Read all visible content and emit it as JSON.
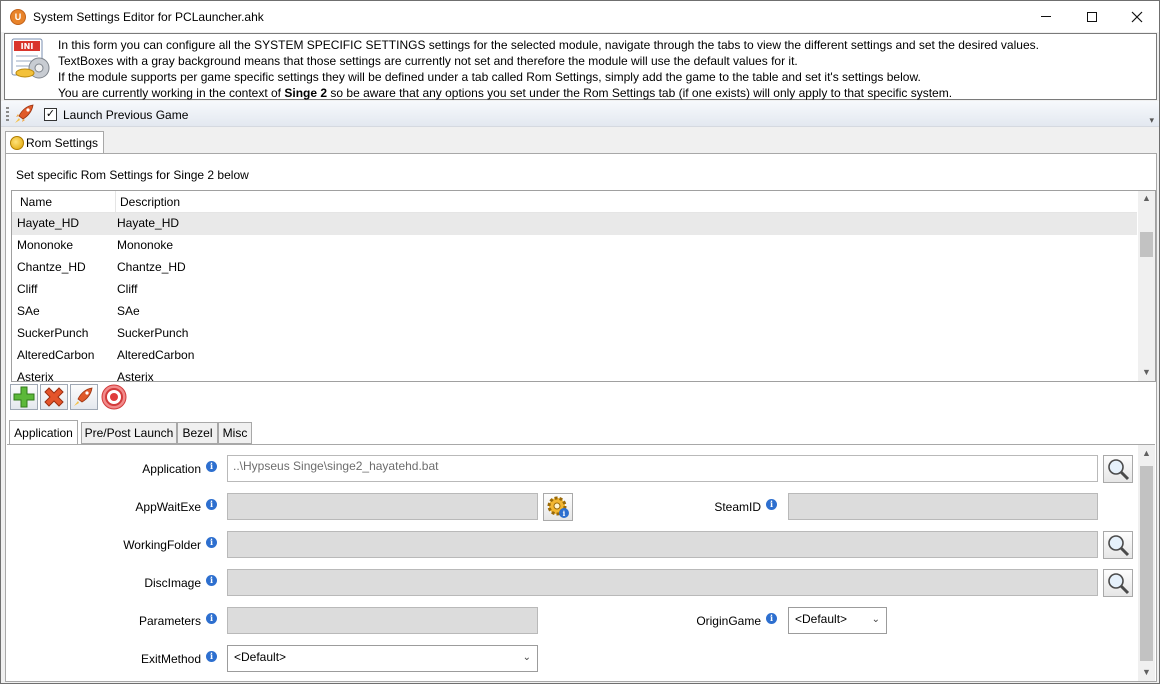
{
  "window": {
    "title": "System Settings Editor for PCLauncher.ahk",
    "app_icon_text": "U"
  },
  "info": {
    "lines": [
      "In this form you can configure all the SYSTEM SPECIFIC SETTINGS settings for the selected module, navigate through the tabs to view the different settings and set the desired values.",
      "TextBoxes with a gray background means that those settings are currently not set and therefore the module will use the default values for it.",
      "If the module supports per game specific settings they will be defined under a tab called Rom Settings, simply add the game to the table and set it's settings below."
    ],
    "context_prefix": "You are currently working in the context of ",
    "context_system": "Singe 2",
    "context_suffix": " so be aware that any options you set under the Rom Settings tab (if one exists) will only apply to that specific system."
  },
  "toolbar": {
    "launch_previous_label": "Launch Previous Game",
    "launch_previous_checked": true,
    "check_glyph": "✓"
  },
  "outer_tab": {
    "label": "Rom Settings"
  },
  "rom_settings": {
    "caption": "Set specific Rom Settings for Singe 2 below",
    "columns": [
      "Name",
      "Description"
    ],
    "rows": [
      {
        "name": "Hayate_HD",
        "description": "Hayate_HD",
        "selected": true
      },
      {
        "name": "Mononoke",
        "description": "Mononoke"
      },
      {
        "name": "Chantze_HD",
        "description": "Chantze_HD"
      },
      {
        "name": "Cliff",
        "description": "Cliff"
      },
      {
        "name": "SAe",
        "description": "SAe"
      },
      {
        "name": "SuckerPunch",
        "description": "SuckerPunch"
      },
      {
        "name": "AlteredCarbon",
        "description": "AlteredCarbon"
      },
      {
        "name": "Asterix",
        "description": "Asterix"
      }
    ],
    "actions": [
      "add-icon",
      "delete-icon",
      "launch-rocket-icon",
      "target-icon"
    ]
  },
  "inner_tabs": [
    "Application",
    "Pre/Post Launch",
    "Bezel",
    "Misc"
  ],
  "form": {
    "application_label": "Application",
    "application_value": "..\\Hypseus Singe\\singe2_hayatehd.bat",
    "appwaitexe_label": "AppWaitExe",
    "appwaitexe_value": "",
    "steamid_label": "SteamID",
    "steamid_value": "",
    "workingfolder_label": "WorkingFolder",
    "workingfolder_value": "",
    "discimage_label": "DiscImage",
    "discimage_value": "",
    "parameters_label": "Parameters",
    "parameters_value": "",
    "origingame_label": "OriginGame",
    "origingame_value": "<Default>",
    "exitmethod_label": "ExitMethod",
    "exitmethod_value": "<Default>",
    "info_glyph": "i"
  }
}
